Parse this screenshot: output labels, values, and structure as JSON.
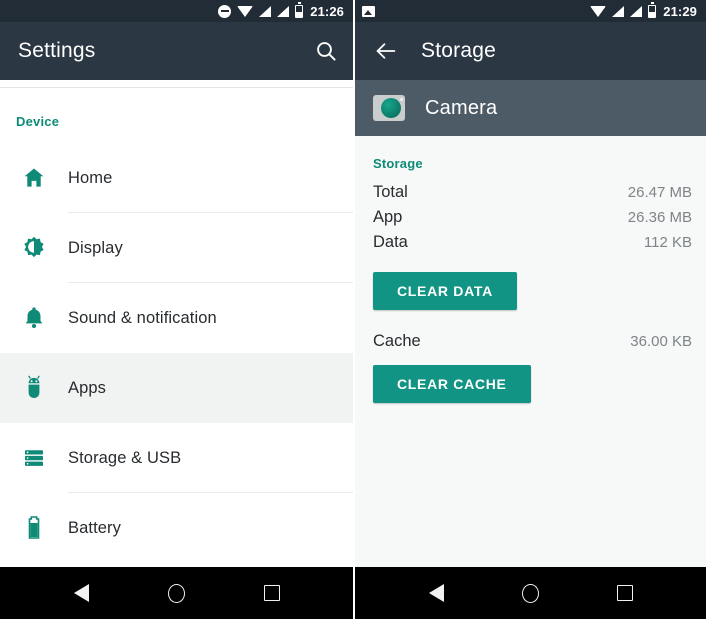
{
  "left": {
    "statusbar": {
      "icons": [
        "do-not-disturb-icon",
        "wifi-icon",
        "signal-icon",
        "signal-icon",
        "battery-icon"
      ],
      "time": "21:26"
    },
    "toolbar": {
      "title": "Settings",
      "search_icon": "search-icon"
    },
    "section_header": "Device",
    "items": [
      {
        "label": "Home",
        "icon": "home-icon",
        "selected": false
      },
      {
        "label": "Display",
        "icon": "brightness-icon",
        "selected": false
      },
      {
        "label": "Sound & notification",
        "icon": "bell-icon",
        "selected": false
      },
      {
        "label": "Apps",
        "icon": "android-robot-icon",
        "selected": true
      },
      {
        "label": "Storage & USB",
        "icon": "storage-icon",
        "selected": false
      },
      {
        "label": "Battery",
        "icon": "battery-icon",
        "selected": false
      }
    ],
    "navbar": {
      "back": "back-triangle-icon",
      "home": "home-circle-icon",
      "recents": "recents-square-icon"
    }
  },
  "right": {
    "statusbar": {
      "icons": [
        "screenshot-image-icon",
        "wifi-icon",
        "signal-icon",
        "signal-icon",
        "battery-icon"
      ],
      "time": "21:29"
    },
    "toolbar": {
      "back_icon": "back-arrow-icon",
      "title": "Storage"
    },
    "app": {
      "icon": "camera-app-icon",
      "name": "Camera"
    },
    "section_header": "Storage",
    "stats": [
      {
        "key": "Total",
        "value": "26.47 MB"
      },
      {
        "key": "App",
        "value": "26.36 MB"
      },
      {
        "key": "Data",
        "value": "112 KB"
      }
    ],
    "clear_data_label": "CLEAR DATA",
    "cache": {
      "key": "Cache",
      "value": "36.00 KB"
    },
    "clear_cache_label": "CLEAR CACHE",
    "navbar": {
      "back": "back-triangle-icon",
      "home": "home-circle-icon",
      "recents": "recents-square-icon"
    }
  },
  "colors": {
    "toolbar": "#2b3742",
    "statusbar": "#222c36",
    "accent_teal": "#0f8a77",
    "button_teal": "#119484",
    "app_header": "#4d5b67",
    "selected_row": "#f1f2f2",
    "detail_bg": "#f7f8f8"
  }
}
